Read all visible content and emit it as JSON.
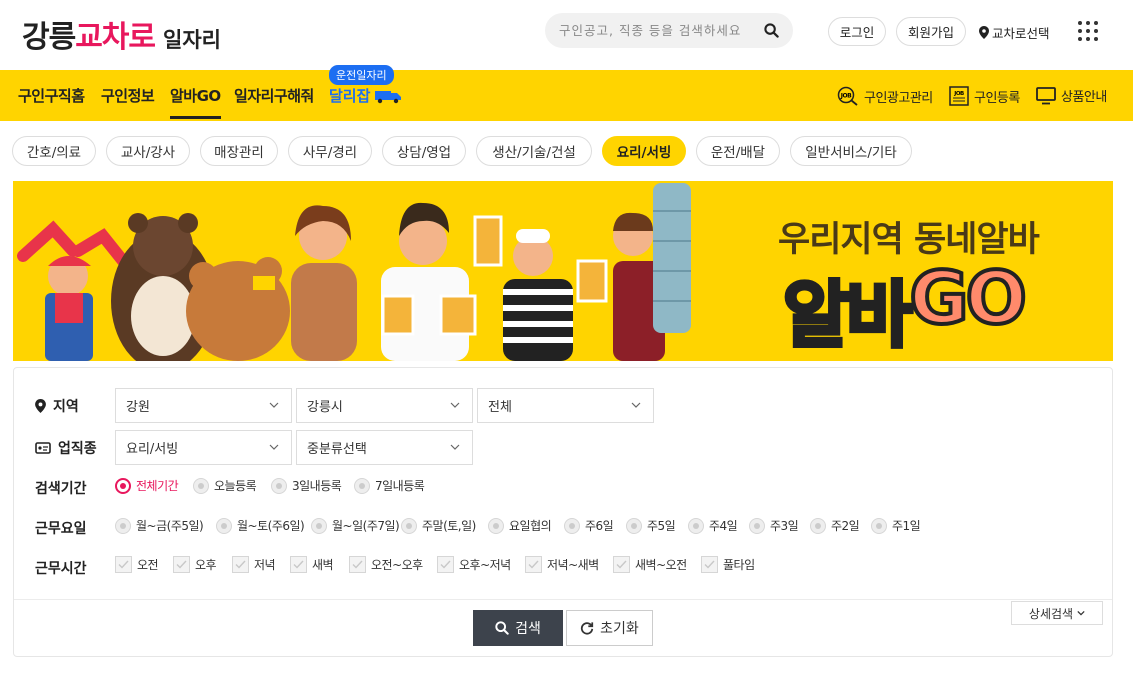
{
  "header": {
    "logo": {
      "part1": "강릉",
      "part2": "교차로",
      "part3": "일자리"
    },
    "search_placeholder": "구인공고, 직종 등을 검색하세요",
    "login": "로그인",
    "signup": "회원가입",
    "region_select": "교차로선택"
  },
  "nav": {
    "items": [
      {
        "label": "구인구직홈"
      },
      {
        "label": "구인정보"
      },
      {
        "label": "알바GO"
      },
      {
        "label": "일자리구해줘"
      }
    ],
    "badge": "운전일자리",
    "dalrijab": "달리잡",
    "right": [
      {
        "label": "구인광고관리"
      },
      {
        "label": "구인등록"
      },
      {
        "label": "상품안내"
      }
    ]
  },
  "categories": [
    "간호/의료",
    "교사/강사",
    "매장관리",
    "사무/경리",
    "상담/영업",
    "생산/기술/건설",
    "요리/서빙",
    "운전/배달",
    "일반서비스/기타"
  ],
  "active_category": "요리/서빙",
  "banner": {
    "tagline": "우리지역 동네알바",
    "big_kor": "알바",
    "big_go": "GO"
  },
  "filters": {
    "region": {
      "label": "지역",
      "province": "강원",
      "city": "강릉시",
      "district": "전체"
    },
    "job": {
      "label": "업직종",
      "main": "요리/서빙",
      "sub": "중분류선택"
    },
    "period": {
      "label": "검색기간",
      "options": [
        "전체기간",
        "오늘등록",
        "3일내등록",
        "7일내등록"
      ],
      "selected": "전체기간"
    },
    "workdays": {
      "label": "근무요일",
      "options": [
        "월~금(주5일)",
        "월~토(주6일)",
        "월~일(주7일)",
        "주말(토,일)",
        "요일협의",
        "주6일",
        "주5일",
        "주4일",
        "주3일",
        "주2일",
        "주1일"
      ]
    },
    "worktime": {
      "label": "근무시간",
      "options": [
        "오전",
        "오후",
        "저녁",
        "새벽",
        "오전~오후",
        "오후~저녁",
        "저녁~새벽",
        "새벽~오전",
        "풀타임"
      ]
    },
    "search_button": "검색",
    "reset_button": "초기화",
    "detail_button": "상세검색"
  }
}
